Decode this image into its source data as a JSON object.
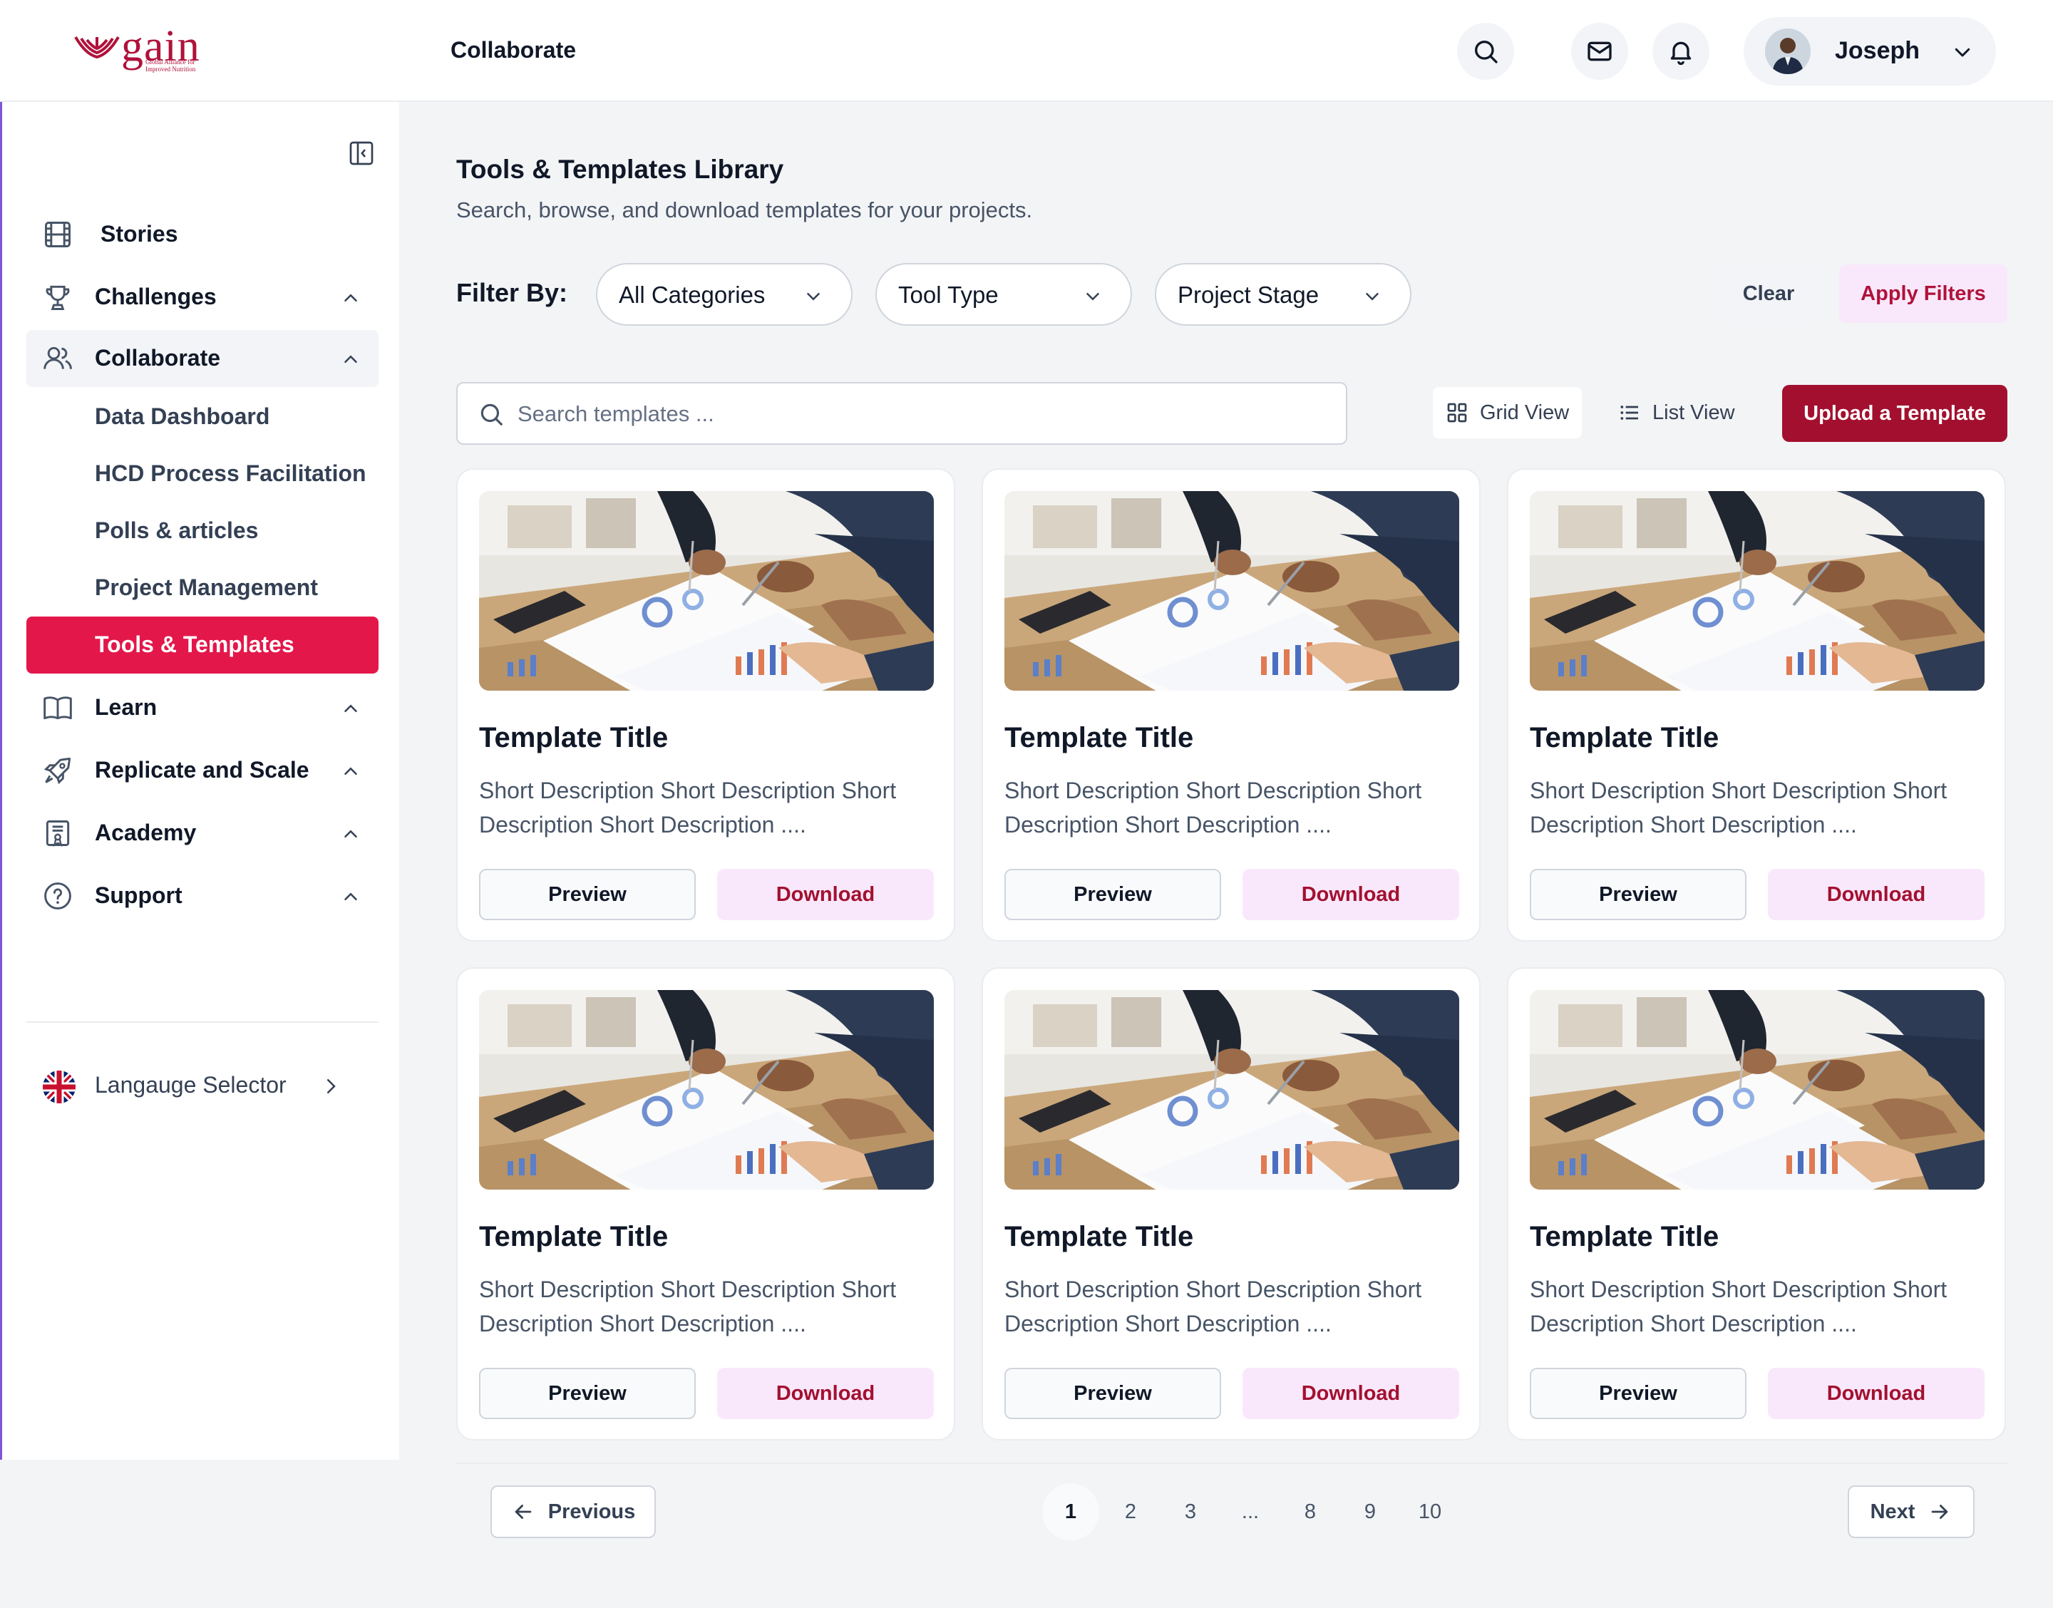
{
  "header": {
    "logo_text": "gain",
    "logo_subtext": "Global Alliance for Improved Nutrition",
    "title": "Collaborate",
    "user_name": "Joseph"
  },
  "sidebar": {
    "items": [
      {
        "label": "Stories",
        "icon": "film-icon"
      },
      {
        "label": "Challenges",
        "icon": "trophy-icon"
      },
      {
        "label": "Collaborate",
        "icon": "users-icon"
      },
      {
        "label": "Learn",
        "icon": "book-icon"
      },
      {
        "label": "Replicate and Scale",
        "icon": "rocket-icon"
      },
      {
        "label": "Academy",
        "icon": "certificate-icon"
      },
      {
        "label": "Support",
        "icon": "help-circle-icon"
      }
    ],
    "collaborate_sub": [
      {
        "label": "Data Dashboard"
      },
      {
        "label": "HCD Process Facilitation"
      },
      {
        "label": "Polls & articles"
      },
      {
        "label": "Project Management"
      },
      {
        "label": "Tools & Templates"
      }
    ],
    "language_label": "Langauge Selector"
  },
  "main": {
    "title": "Tools & Templates Library",
    "subtitle": "Search, browse, and download templates for your projects.",
    "filter_label": "Filter By:",
    "filters": [
      "All Categories",
      "Tool Type",
      "Project Stage"
    ],
    "clear_label": "Clear",
    "apply_label": "Apply Filters",
    "search_placeholder": "Search templates ...",
    "grid_view_label": "Grid View",
    "list_view_label": "List View",
    "upload_label": "Upload a Template"
  },
  "cards": [
    {
      "title": "Template Title",
      "desc": "Short Description Short Description Short Description Short Description ....",
      "preview": "Preview",
      "download": "Download"
    },
    {
      "title": "Template Title",
      "desc": "Short Description Short Description Short Description Short Description ....",
      "preview": "Preview",
      "download": "Download"
    },
    {
      "title": "Template Title",
      "desc": "Short Description Short Description Short Description Short Description ....",
      "preview": "Preview",
      "download": "Download"
    },
    {
      "title": "Template Title",
      "desc": "Short Description Short Description Short Description Short Description ....",
      "preview": "Preview",
      "download": "Download"
    },
    {
      "title": "Template Title",
      "desc": "Short Description Short Description Short Description Short Description ....",
      "preview": "Preview",
      "download": "Download"
    },
    {
      "title": "Template Title",
      "desc": "Short Description Short Description Short Description Short Description ....",
      "preview": "Preview",
      "download": "Download"
    }
  ],
  "pagination": {
    "previous": "Previous",
    "next": "Next",
    "pages": [
      "1",
      "2",
      "3",
      "...",
      "8",
      "9",
      "10"
    ],
    "current": "1"
  },
  "colors": {
    "brand": "#a3102f",
    "active_nav": "#e3174a",
    "soft_pink": "#f9e8fb"
  }
}
